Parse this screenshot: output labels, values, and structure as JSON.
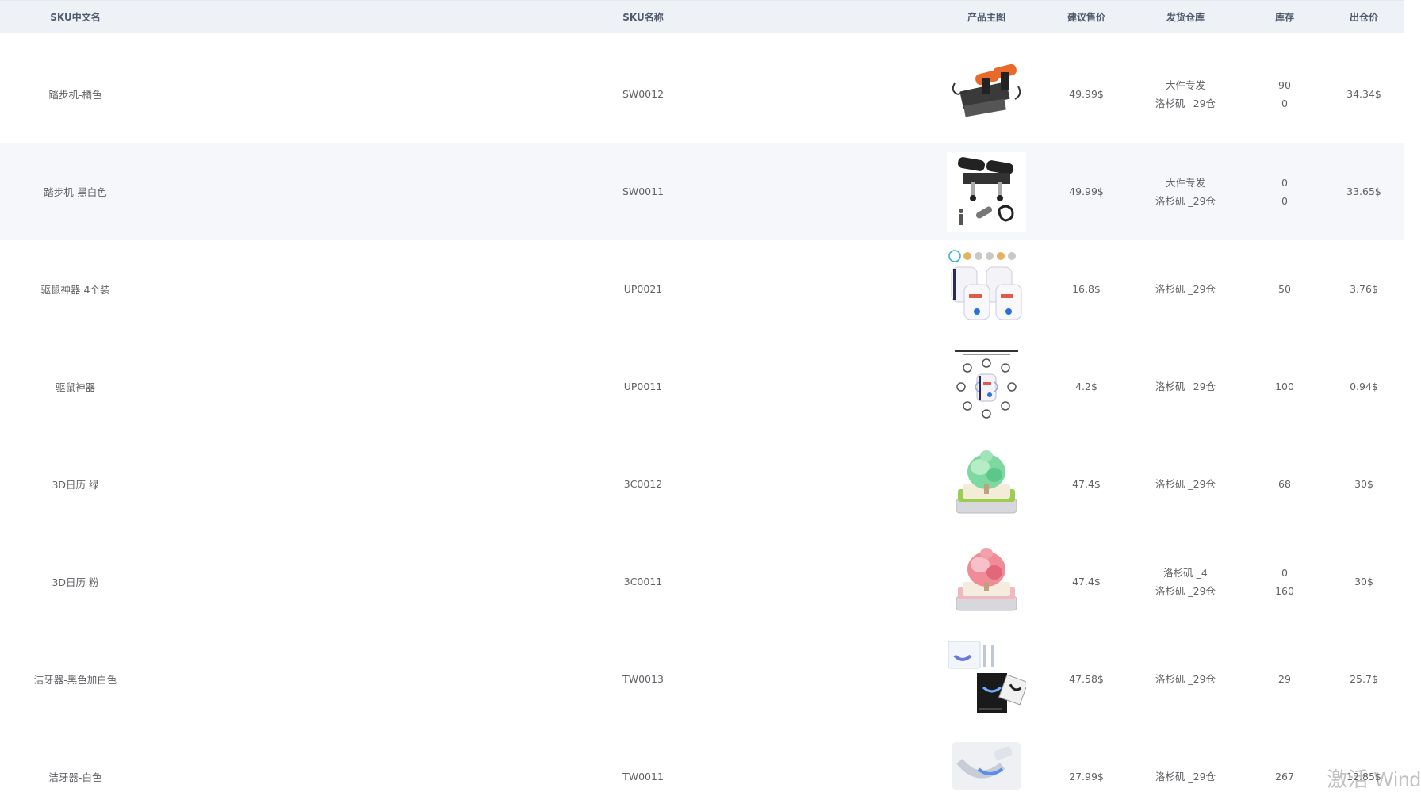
{
  "headers": {
    "cn_name": "SKU中文名",
    "sku_name": "SKU名称",
    "image": "产品主图",
    "price": "建议售价",
    "warehouse": "发货仓库",
    "stock": "库存",
    "out_price": "出仓价"
  },
  "rows": [
    {
      "cn": "踏步机-橘色",
      "sku": "SW0012",
      "image": "orange-stepper-icon",
      "price": "49.99$",
      "wh1": "大件专发",
      "wh2": "洛杉矶 _29仓",
      "stock1": "90",
      "stock2": "0",
      "out": "34.34$"
    },
    {
      "cn": "踏步机-黑白色",
      "sku": "SW0011",
      "image": "black-stepper-icon",
      "price": "49.99$",
      "wh1": "大件专发",
      "wh2": "洛杉矶 _29仓",
      "stock1": "0",
      "stock2": "0",
      "out": "33.65$"
    },
    {
      "cn": "驱鼠神器 4个装",
      "sku": "UP0021",
      "image": "repeller-4pack-icon",
      "price": "16.8$",
      "wh1": "洛杉矶 _29仓",
      "stock1": "50",
      "out": "3.76$"
    },
    {
      "cn": "驱鼠神器",
      "sku": "UP0011",
      "image": "repeller-single-icon",
      "price": "4.2$",
      "wh1": "洛杉矶 _29仓",
      "stock1": "100",
      "out": "0.94$"
    },
    {
      "cn": "3D日历 绿",
      "sku": "3C0012",
      "image": "green-calendar-icon",
      "price": "47.4$",
      "wh1": "洛杉矶 _29仓",
      "stock1": "68",
      "out": "30$"
    },
    {
      "cn": "3D日历 粉",
      "sku": "3C0011",
      "image": "pink-calendar-icon",
      "price": "47.4$",
      "wh1": "洛杉矶 _4",
      "wh2": "洛杉矶 _29仓",
      "stock1": "0",
      "stock2": "160",
      "out": "30$"
    },
    {
      "cn": "洁牙器-黑色加白色",
      "sku": "TW0013",
      "image": "teeth-whitener-kit-icon",
      "price": "47.58$",
      "wh1": "洛杉矶 _29仓",
      "stock1": "29",
      "out": "25.7$"
    },
    {
      "cn": "洁牙器-白色",
      "sku": "TW0011",
      "image": "teeth-whitener-white-icon",
      "price": "27.99$",
      "wh1": "洛杉矶 _29仓",
      "stock1": "267",
      "out": "12.85$"
    }
  ],
  "watermark": "激活 Wind",
  "colors": {
    "header_bg": "#eef1f5",
    "hover_row_bg": "#f5f7fa",
    "text": "#606266"
  }
}
